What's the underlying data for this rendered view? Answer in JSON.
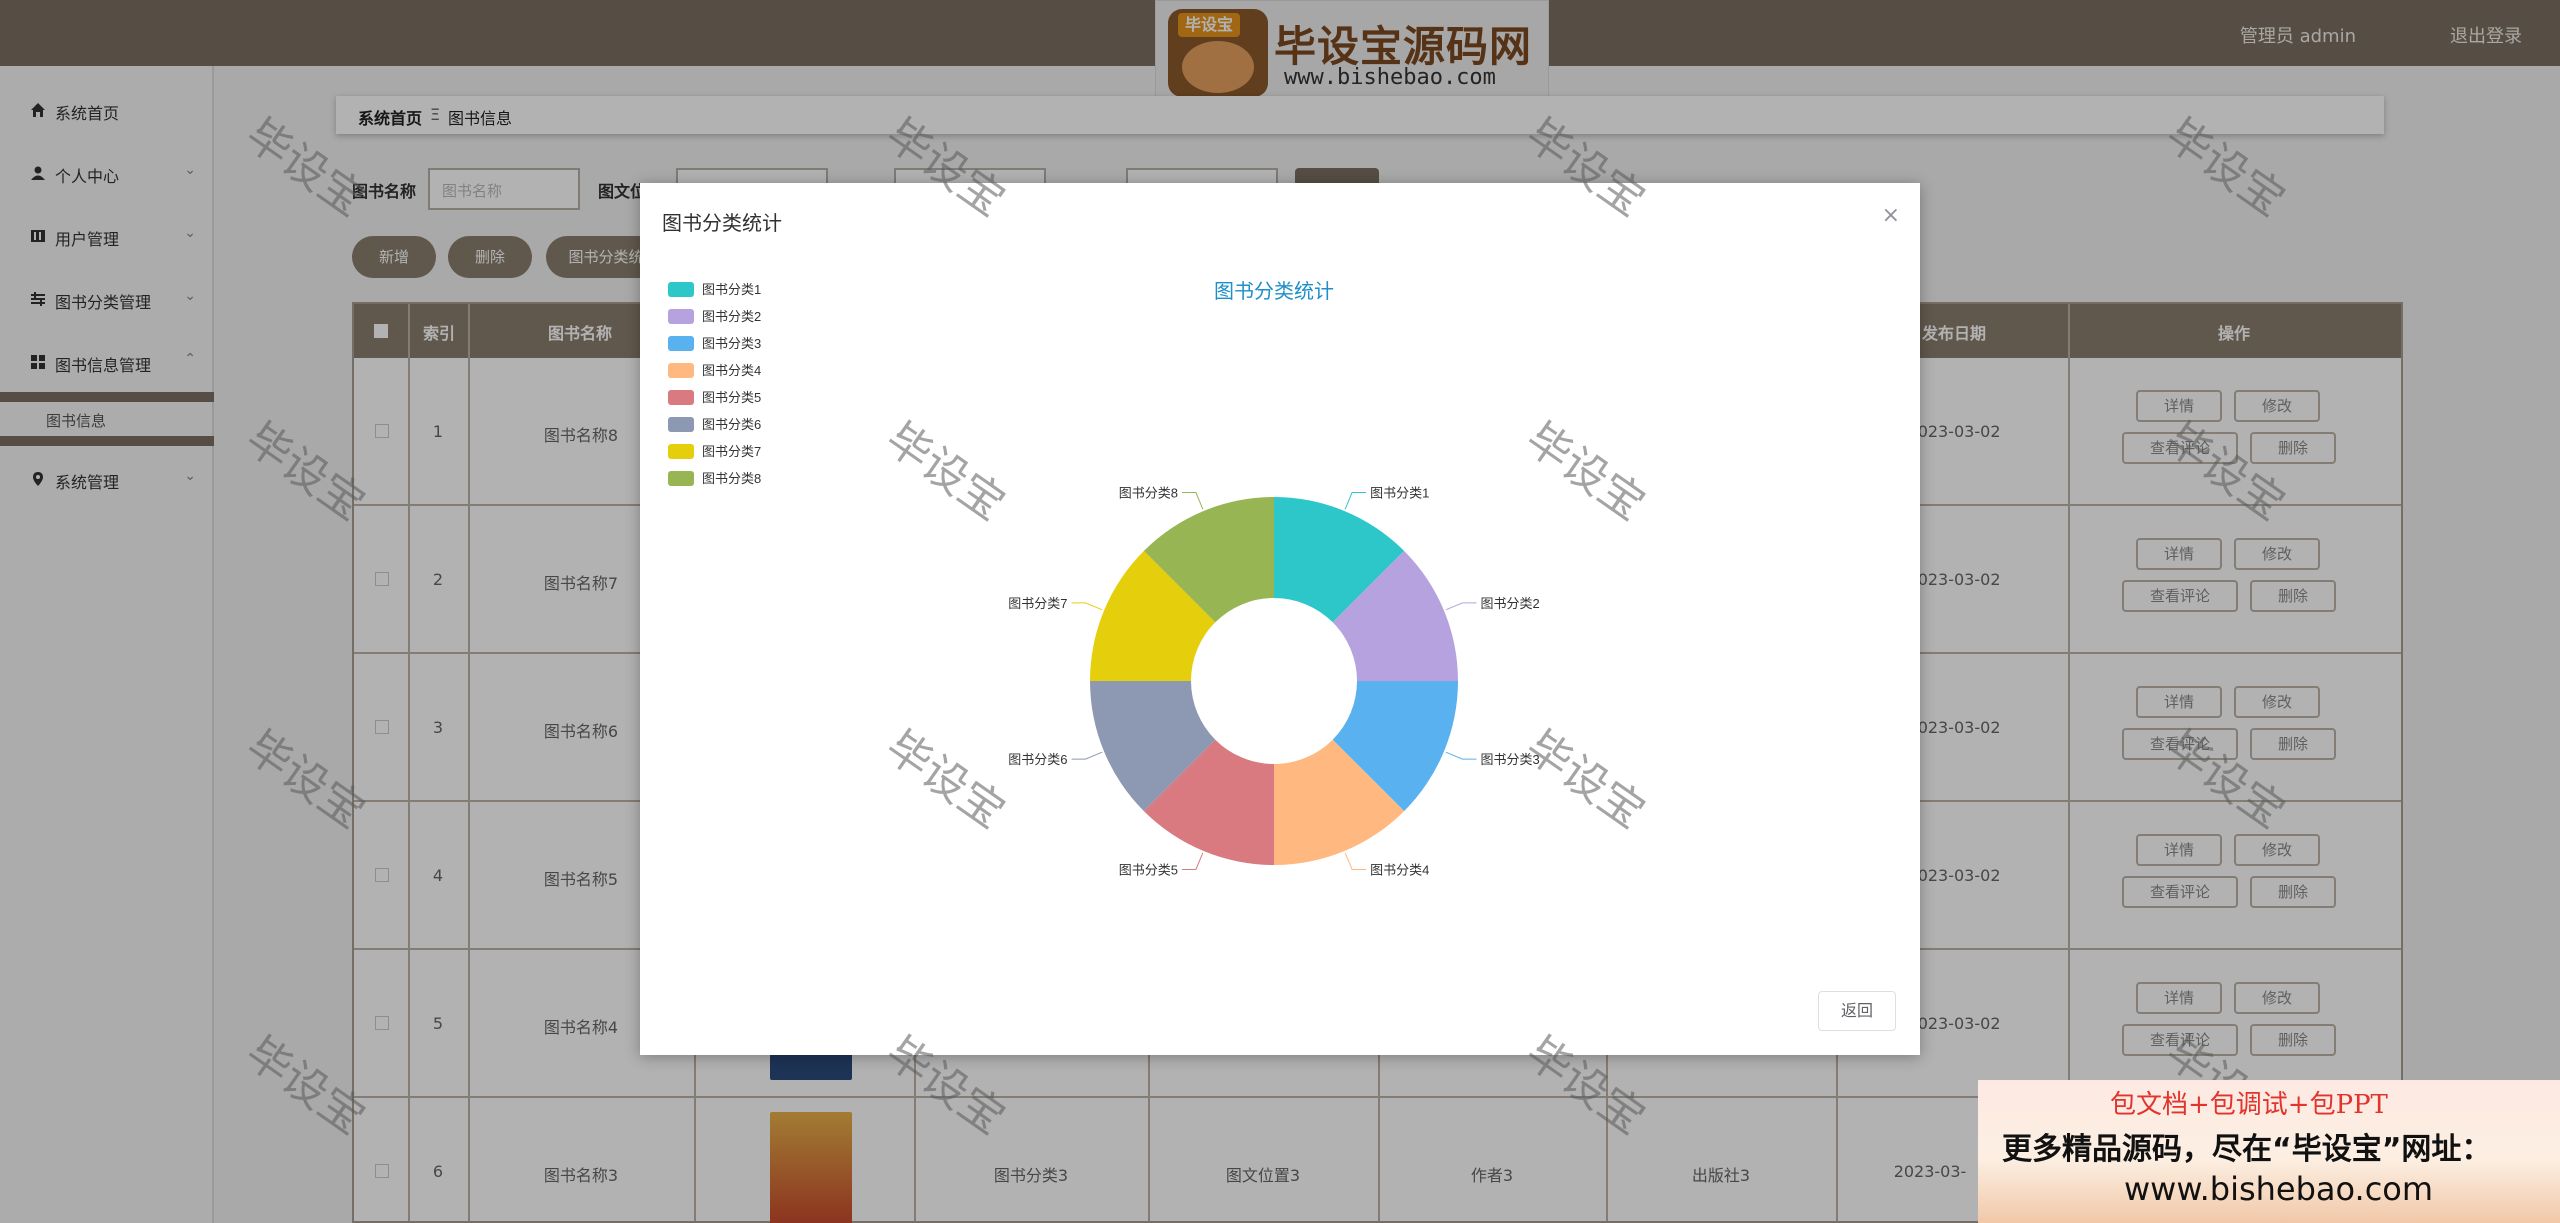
{
  "header": {
    "logo_tag": "毕设宝",
    "logo_brand": "毕设宝源码网",
    "logo_url": "www.bishebao.com",
    "user": "管理员 admin",
    "logout": "退出登录"
  },
  "sidebar": {
    "items": [
      {
        "label": "系统首页",
        "icon": "home-icon"
      },
      {
        "label": "个人中心",
        "icon": "user-icon"
      },
      {
        "label": "用户管理",
        "icon": "book-icon"
      },
      {
        "label": "图书分类管理",
        "icon": "sliders-icon"
      },
      {
        "label": "图书信息管理",
        "icon": "grid-icon"
      },
      {
        "label": "系统管理",
        "icon": "location-icon"
      }
    ],
    "sub_item": "图书信息"
  },
  "breadcrumb": {
    "home": "系统首页",
    "separator": "Ξ",
    "current": "图书信息"
  },
  "filters": {
    "book_name_label": "图书名称",
    "book_name_placeholder": "图书名称",
    "second_label": "图文位"
  },
  "actions": {
    "add": "新增",
    "delete": "删除",
    "stats": "图书分类统"
  },
  "table": {
    "columns": {
      "index": "索引",
      "name": "图书名称",
      "publish_date": "发布日期",
      "operation": "操作"
    },
    "rows": [
      {
        "index": "1",
        "name": "图书名称8",
        "date": "2023-03-02"
      },
      {
        "index": "2",
        "name": "图书名称7",
        "date": "2023-03-02"
      },
      {
        "index": "3",
        "name": "图书名称6",
        "date": "2023-03-02"
      },
      {
        "index": "4",
        "name": "图书名称5",
        "date": "2023-03-02"
      },
      {
        "index": "5",
        "name": "图书名称4",
        "date": "2023-03-02"
      },
      {
        "index": "6",
        "name": "图书名称3",
        "date": "2023-03-",
        "category": "图书分类3",
        "position": "图文位置3",
        "author": "作者3",
        "publisher": "出版社3"
      }
    ],
    "ops": {
      "detail": "详情",
      "edit": "修改",
      "comments": "查看评论",
      "delete": "删除"
    }
  },
  "modal": {
    "title": "图书分类统计",
    "close": "×",
    "return_label": "返回"
  },
  "chart_data": {
    "type": "pie",
    "title": "图书分类统计",
    "donut": true,
    "legend_position": "top-left",
    "categories": [
      "图书分类1",
      "图书分类2",
      "图书分类3",
      "图书分类4",
      "图书分类5",
      "图书分类6",
      "图书分类7",
      "图书分类8"
    ],
    "values": [
      1,
      1,
      1,
      1,
      1,
      1,
      1,
      1
    ],
    "colors": [
      "#2ec7c9",
      "#b6a2de",
      "#5ab1ef",
      "#ffb980",
      "#d87a80",
      "#8d98b3",
      "#e5cf0d",
      "#97b552"
    ]
  },
  "watermark": "毕设宝",
  "ad": {
    "line1": "包文档+包调试+包PPT",
    "line2": "更多精品源码，尽在“毕设宝”网址：",
    "line3": "www.bishebao.com"
  }
}
